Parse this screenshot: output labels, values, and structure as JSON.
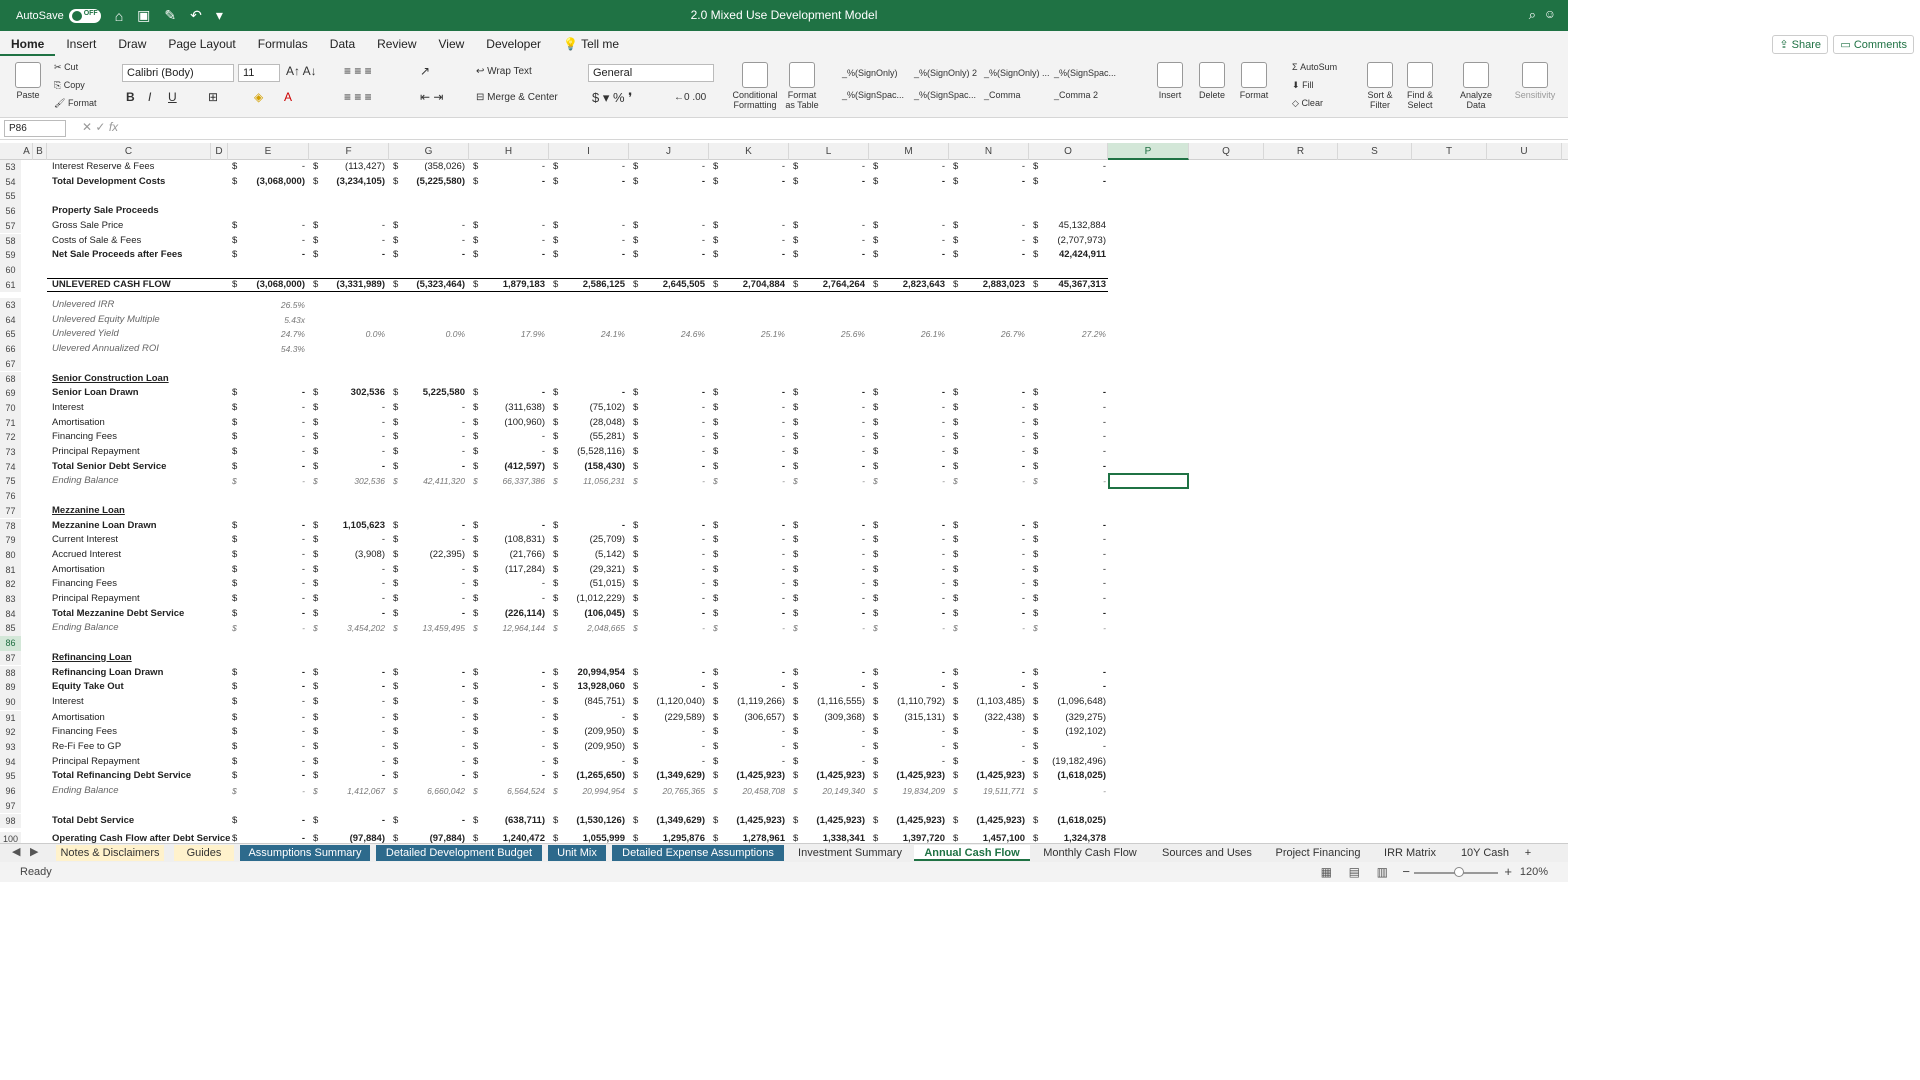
{
  "titlebar": {
    "autosave": "AutoSave",
    "off": "OFF",
    "doc_title": "2.0 Mixed Use Development Model"
  },
  "menu": [
    "Home",
    "Insert",
    "Draw",
    "Page Layout",
    "Formulas",
    "Data",
    "Review",
    "View",
    "Developer"
  ],
  "tell_me": "Tell me",
  "share": "Share",
  "comments": "Comments",
  "ribbon": {
    "paste": "Paste",
    "cut": "Cut",
    "copy": "Copy",
    "format": "Format",
    "font": "Calibri (Body)",
    "size": "11",
    "wrap": "Wrap Text",
    "merge": "Merge & Center",
    "number_format": "General",
    "cond_fmt": "Conditional Formatting",
    "fmt_table": "Format as Table",
    "styles": [
      "_%(SignOnly)",
      "_%(SignOnly) 2",
      "_%(SignOnly) ...",
      "_%(SignSpac...",
      "_%(SignSpac...",
      "_%(SignSpac...",
      "_Comma",
      "_Comma 2"
    ],
    "insert": "Insert",
    "delete": "Delete",
    "format2": "Format",
    "autosum": "AutoSum",
    "fill": "Fill",
    "clear": "Clear",
    "sort": "Sort & Filter",
    "find": "Find & Select",
    "analyze": "Analyze Data",
    "sensitivity": "Sensitivity"
  },
  "namebox": "P86",
  "fx": "fx",
  "columns": [
    "A",
    "B",
    "C",
    "D",
    "E",
    "F",
    "G",
    "H",
    "I",
    "J",
    "K",
    "L",
    "M",
    "N",
    "O",
    "P",
    "Q",
    "R",
    "S",
    "T",
    "U"
  ],
  "rows": [
    {
      "n": "53",
      "label": "Interest Reserve & Fees",
      "style": "",
      "vals": [
        "-",
        "(113,427)",
        "(358,026)",
        "-",
        "-",
        "-",
        "-",
        "-",
        "-",
        "-",
        "-"
      ]
    },
    {
      "n": "54",
      "label": "Total Development Costs",
      "style": "b",
      "vals": [
        "(3,068,000)",
        "(3,234,105)",
        "(5,225,580)",
        "-",
        "-",
        "-",
        "-",
        "-",
        "-",
        "-",
        "-"
      ]
    },
    {
      "n": "55",
      "label": "",
      "style": "",
      "vals": []
    },
    {
      "n": "56",
      "label": "Property Sale Proceeds",
      "style": "b",
      "vals": []
    },
    {
      "n": "57",
      "label": "Gross Sale Price",
      "style": "",
      "vals": [
        "-",
        "-",
        "-",
        "-",
        "-",
        "-",
        "-",
        "-",
        "-",
        "-",
        "45,132,884"
      ]
    },
    {
      "n": "58",
      "label": "Costs of Sale & Fees",
      "style": "",
      "vals": [
        "-",
        "-",
        "-",
        "-",
        "-",
        "-",
        "-",
        "-",
        "-",
        "-",
        "(2,707,973)"
      ]
    },
    {
      "n": "59",
      "label": "Net Sale Proceeds after Fees",
      "style": "b",
      "vals": [
        "-",
        "-",
        "-",
        "-",
        "-",
        "-",
        "-",
        "-",
        "-",
        "-",
        "42,424,911"
      ]
    },
    {
      "n": "60",
      "label": "",
      "style": "",
      "vals": []
    },
    {
      "n": "61",
      "label": "UNLEVERED CASH FLOW",
      "style": "b",
      "vals": [
        "(3,068,000)",
        "(3,331,989)",
        "(5,323,464)",
        "1,879,183",
        "2,586,125",
        "2,645,505",
        "2,704,884",
        "2,764,264",
        "2,823,643",
        "2,883,023",
        "45,367,313"
      ]
    },
    {
      "n": "63",
      "label": "Unlevered  IRR",
      "style": "i",
      "metric": "26.5%"
    },
    {
      "n": "64",
      "label": "Unlevered Equity Multiple",
      "style": "i",
      "metric": "5.43x"
    },
    {
      "n": "65",
      "label": "Unlevered  Yield",
      "style": "i",
      "metric": "24.7%",
      "yields": [
        "0.0%",
        "0.0%",
        "17.9%",
        "24.1%",
        "24.6%",
        "25.1%",
        "25.6%",
        "26.1%",
        "26.7%",
        "27.2%"
      ]
    },
    {
      "n": "66",
      "label": "Ulevered  Annualized ROI",
      "style": "i",
      "metric": "54.3%"
    },
    {
      "n": "67",
      "label": "",
      "style": "",
      "vals": []
    },
    {
      "n": "68",
      "label": "Senior Construction Loan",
      "style": "u",
      "vals": []
    },
    {
      "n": "69",
      "label": "Senior Loan Drawn",
      "style": "b",
      "vals": [
        "-",
        "302,536",
        "5,225,580",
        "-",
        "-",
        "-",
        "-",
        "-",
        "-",
        "-",
        "-"
      ]
    },
    {
      "n": "70",
      "label": "Interest",
      "style": "",
      "vals": [
        "-",
        "-",
        "-",
        "(311,638)",
        "(75,102)",
        "-",
        "-",
        "-",
        "-",
        "-",
        "-"
      ]
    },
    {
      "n": "71",
      "label": "Amortisation",
      "style": "",
      "vals": [
        "-",
        "-",
        "-",
        "(100,960)",
        "(28,048)",
        "-",
        "-",
        "-",
        "-",
        "-",
        "-"
      ]
    },
    {
      "n": "72",
      "label": "Financing Fees",
      "style": "",
      "vals": [
        "-",
        "-",
        "-",
        "-",
        "(55,281)",
        "-",
        "-",
        "-",
        "-",
        "-",
        "-"
      ]
    },
    {
      "n": "73",
      "label": "Principal Repayment",
      "style": "",
      "vals": [
        "-",
        "-",
        "-",
        "-",
        "(5,528,116)",
        "-",
        "-",
        "-",
        "-",
        "-",
        "-"
      ]
    },
    {
      "n": "74",
      "label": "Total Senior Debt Service",
      "style": "b",
      "vals": [
        "-",
        "-",
        "-",
        "(412,597)",
        "(158,430)",
        "-",
        "-",
        "-",
        "-",
        "-",
        "-"
      ]
    },
    {
      "n": "75",
      "label": "Ending Balance",
      "style": "i",
      "vals": [
        "-",
        "302,536",
        "42,411,320",
        "66,337,386",
        "11,056,231",
        "-",
        "-",
        "-",
        "-",
        "-",
        "-"
      ]
    },
    {
      "n": "76",
      "label": "",
      "style": "",
      "vals": []
    },
    {
      "n": "77",
      "label": "Mezzanine Loan",
      "style": "u",
      "vals": []
    },
    {
      "n": "78",
      "label": "Mezzanine Loan Drawn",
      "style": "b",
      "vals": [
        "-",
        "1,105,623",
        "-",
        "-",
        "-",
        "-",
        "-",
        "-",
        "-",
        "-",
        "-"
      ]
    },
    {
      "n": "79",
      "label": "Current Interest",
      "style": "",
      "vals": [
        "-",
        "-",
        "-",
        "(108,831)",
        "(25,709)",
        "-",
        "-",
        "-",
        "-",
        "-",
        "-"
      ]
    },
    {
      "n": "80",
      "label": "Accrued Interest",
      "style": "",
      "vals": [
        "-",
        "(3,908)",
        "(22,395)",
        "(21,766)",
        "(5,142)",
        "-",
        "-",
        "-",
        "-",
        "-",
        "-"
      ]
    },
    {
      "n": "81",
      "label": "Amortisation",
      "style": "",
      "vals": [
        "-",
        "-",
        "-",
        "(117,284)",
        "(29,321)",
        "-",
        "-",
        "-",
        "-",
        "-",
        "-"
      ]
    },
    {
      "n": "82",
      "label": "Financing Fees",
      "style": "",
      "vals": [
        "-",
        "-",
        "-",
        "-",
        "(51,015)",
        "-",
        "-",
        "-",
        "-",
        "-",
        "-"
      ]
    },
    {
      "n": "83",
      "label": "Principal Repayment",
      "style": "",
      "vals": [
        "-",
        "-",
        "-",
        "-",
        "(1,012,229)",
        "-",
        "-",
        "-",
        "-",
        "-",
        "-"
      ]
    },
    {
      "n": "84",
      "label": "Total Mezzanine Debt Service",
      "style": "b",
      "vals": [
        "-",
        "-",
        "-",
        "(226,114)",
        "(106,045)",
        "-",
        "-",
        "-",
        "-",
        "-",
        "-"
      ]
    },
    {
      "n": "85",
      "label": "Ending Balance",
      "style": "i",
      "vals": [
        "-",
        "3,454,202",
        "13,459,495",
        "12,964,144",
        "2,048,665",
        "-",
        "-",
        "-",
        "-",
        "-",
        "-"
      ]
    },
    {
      "n": "86",
      "label": "",
      "style": "",
      "vals": []
    },
    {
      "n": "87",
      "label": "Refinancing Loan",
      "style": "u",
      "vals": []
    },
    {
      "n": "88",
      "label": "Refinancing Loan Drawn",
      "style": "b",
      "vals": [
        "-",
        "-",
        "-",
        "-",
        "20,994,954",
        "-",
        "-",
        "-",
        "-",
        "-",
        "-"
      ]
    },
    {
      "n": "89",
      "label": "Equity Take Out",
      "style": "b",
      "vals": [
        "-",
        "-",
        "-",
        "-",
        "13,928,060",
        "-",
        "-",
        "-",
        "-",
        "-",
        "-"
      ]
    },
    {
      "n": "90",
      "label": "Interest",
      "style": "",
      "vals": [
        "-",
        "-",
        "-",
        "-",
        "(845,751)",
        "(1,120,040)",
        "(1,119,266)",
        "(1,116,555)",
        "(1,110,792)",
        "(1,103,485)",
        "(1,096,648)"
      ]
    },
    {
      "n": "91",
      "label": "Amortisation",
      "style": "",
      "vals": [
        "-",
        "-",
        "-",
        "-",
        "-",
        "(229,589)",
        "(306,657)",
        "(309,368)",
        "(315,131)",
        "(322,438)",
        "(329,275)"
      ]
    },
    {
      "n": "92",
      "label": "Financing Fees",
      "style": "",
      "vals": [
        "-",
        "-",
        "-",
        "-",
        "(209,950)",
        "-",
        "-",
        "-",
        "-",
        "-",
        "(192,102)"
      ]
    },
    {
      "n": "93",
      "label": "Re-Fi Fee to GP",
      "style": "",
      "vals": [
        "-",
        "-",
        "-",
        "-",
        "(209,950)",
        "-",
        "-",
        "-",
        "-",
        "-",
        "-"
      ]
    },
    {
      "n": "94",
      "label": "Principal Repayment",
      "style": "",
      "vals": [
        "-",
        "-",
        "-",
        "-",
        "-",
        "-",
        "-",
        "-",
        "-",
        "-",
        "(19,182,496)"
      ]
    },
    {
      "n": "95",
      "label": "Total Refinancing Debt Service",
      "style": "b",
      "vals": [
        "-",
        "-",
        "-",
        "-",
        "(1,265,650)",
        "(1,349,629)",
        "(1,425,923)",
        "(1,425,923)",
        "(1,425,923)",
        "(1,425,923)",
        "(1,618,025)"
      ]
    },
    {
      "n": "96",
      "label": "Ending Balance",
      "style": "i",
      "vals": [
        "-",
        "1,412,067",
        "6,660,042",
        "6,564,524",
        "20,994,954",
        "20,765,365",
        "20,458,708",
        "20,149,340",
        "19,834,209",
        "19,511,771",
        "-"
      ]
    },
    {
      "n": "97",
      "label": "",
      "style": "",
      "vals": []
    },
    {
      "n": "98",
      "label": "Total Debt Service",
      "style": "b",
      "vals": [
        "-",
        "-",
        "-",
        "(638,711)",
        "(1,530,126)",
        "(1,349,629)",
        "(1,425,923)",
        "(1,425,923)",
        "(1,425,923)",
        "(1,425,923)",
        "(1,618,025)"
      ]
    },
    {
      "n": "100",
      "label": "Operating Cash Flow after Debt Service",
      "style": "b",
      "vals": [
        "-",
        "(97,884)",
        "(97,884)",
        "1,240,472",
        "1,055,999",
        "1,295,876",
        "1,278,961",
        "1,338,341",
        "1,397,720",
        "1,457,100",
        "1,324,378"
      ]
    }
  ],
  "sheet_tabs": [
    "Notes & Disclaimers",
    "Guides",
    "Assumptions Summary",
    "Detailed Development Budget",
    "Unit Mix",
    "Detailed Expense Assumptions",
    "Investment Summary",
    "Annual Cash Flow",
    "Monthly Cash Flow",
    "Sources and Uses",
    "Project Financing",
    "IRR Matrix",
    "10Y Cash"
  ],
  "status": {
    "ready": "Ready",
    "zoom": "120%"
  }
}
